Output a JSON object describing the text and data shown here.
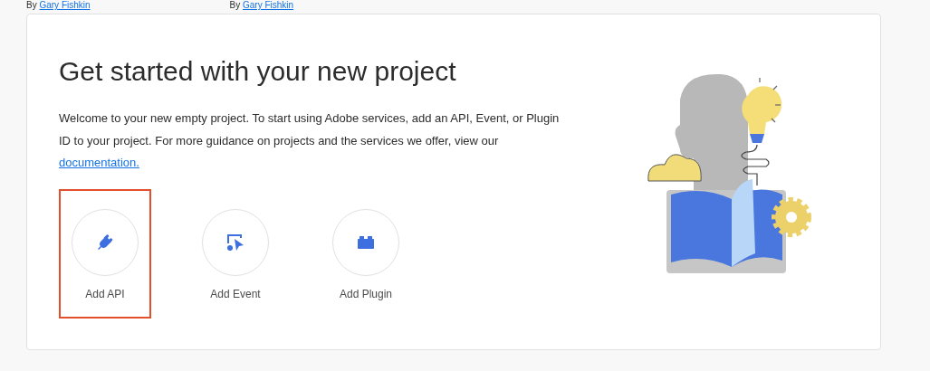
{
  "bylines": [
    {
      "prefix": "By",
      "author": "Gary Fishkin"
    },
    {
      "prefix": "By",
      "author": "Gary Fishkin"
    }
  ],
  "card": {
    "title": "Get started with your new project",
    "description": "Welcome to your new empty project. To start using Adobe services, add an API, Event, or Plugin ID to your project. For more guidance on projects and the services we offer, view our",
    "link": "documentation.",
    "actions": [
      {
        "kind": "api",
        "label": "Add API",
        "highlighted": true
      },
      {
        "kind": "event",
        "label": "Add Event",
        "highlighted": false
      },
      {
        "kind": "plugin",
        "label": "Add Plugin",
        "highlighted": false
      }
    ]
  }
}
